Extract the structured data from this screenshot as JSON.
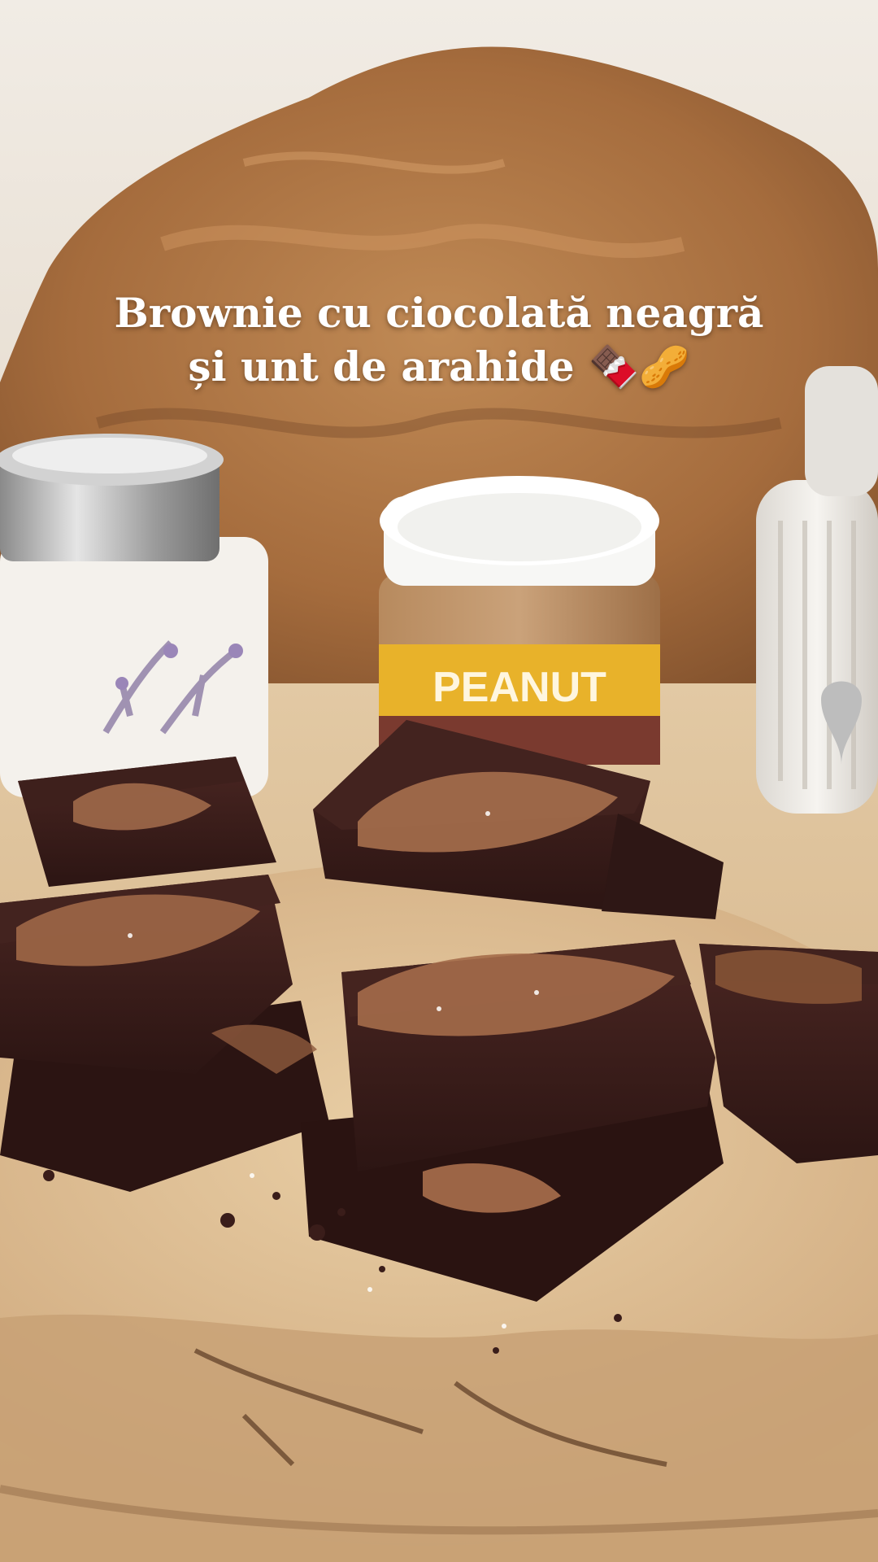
{
  "caption": {
    "line1": "Brownie cu ciocolată neagră",
    "line2": "și unt de arahide",
    "emojis": "🍫🥜"
  },
  "jar_label": {
    "text": "PEANUT"
  },
  "colors": {
    "wall": "#ece6de",
    "wood_board": "#b07a48",
    "table": "#dcc09a",
    "brownie": "#3b1f1c",
    "peanut_topping": "#a0694a",
    "jar_label": "#e8b22a"
  }
}
